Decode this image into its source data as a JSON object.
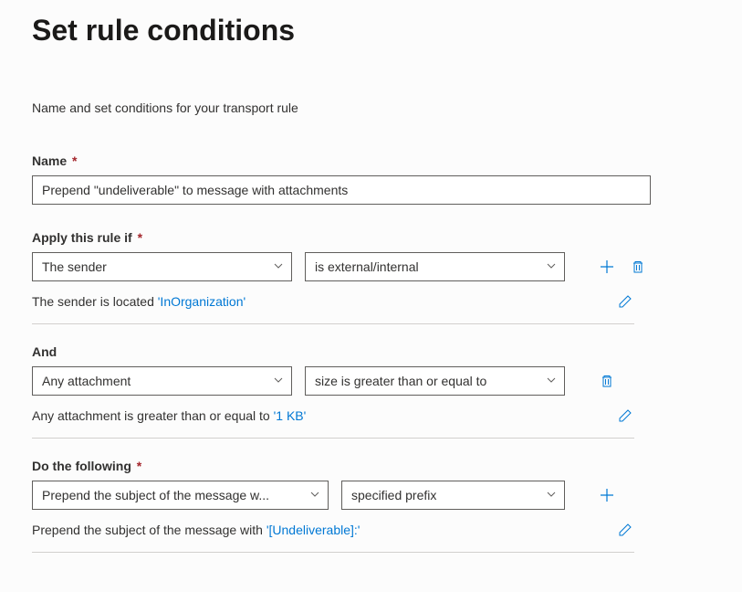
{
  "title": "Set rule conditions",
  "description": "Name and set conditions for your transport rule",
  "name": {
    "label": "Name",
    "value": "Prepend \"undeliverable\" to message with attachments"
  },
  "apply_if": {
    "label": "Apply this rule if",
    "dd1": "The sender",
    "dd2": "is external/internal",
    "summary_prefix": "The sender is located ",
    "summary_value": "'InOrganization'"
  },
  "and_label": "And",
  "and_cond": {
    "dd1": "Any attachment",
    "dd2": "size is greater than or equal to",
    "summary_prefix": "Any attachment is greater than or equal to ",
    "summary_value": "'1 KB'"
  },
  "do_following": {
    "label": "Do the following",
    "dd1": "Prepend the subject of the message w...",
    "dd2": "specified prefix",
    "summary_prefix": "Prepend the subject of the message with ",
    "summary_value": "'[Undeliverable]:'"
  }
}
